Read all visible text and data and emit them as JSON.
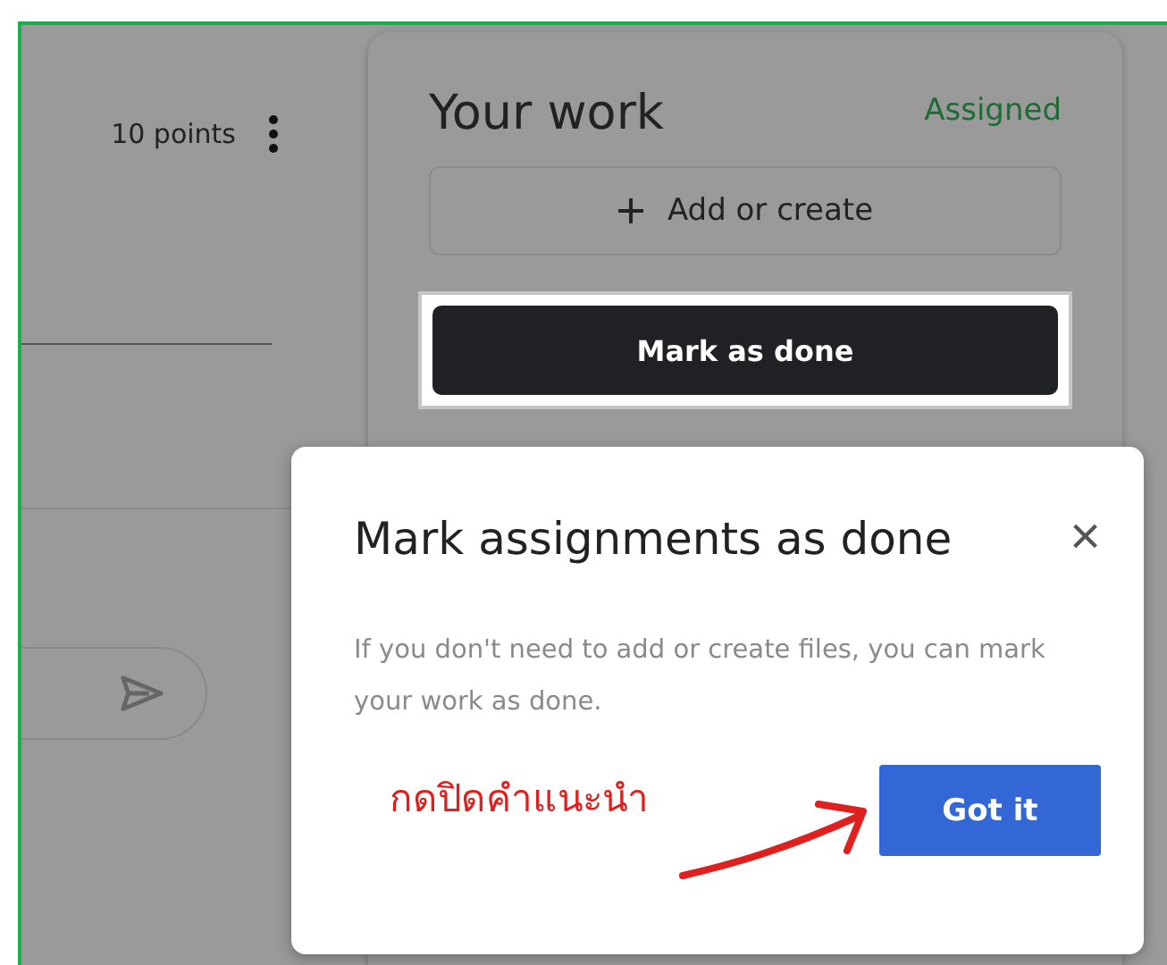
{
  "assignment": {
    "points": "10 points"
  },
  "your_work": {
    "title": "Your work",
    "status": "Assigned",
    "add_button": "Add or create",
    "done_button": "Mark as done"
  },
  "tip": {
    "title": "Mark assignments as done",
    "close": "×",
    "body": "If you don't need to add or create files, you can mark your work as done.",
    "button": "Got it"
  },
  "annotation": {
    "text": "กดปิดคำแนะนำ"
  }
}
